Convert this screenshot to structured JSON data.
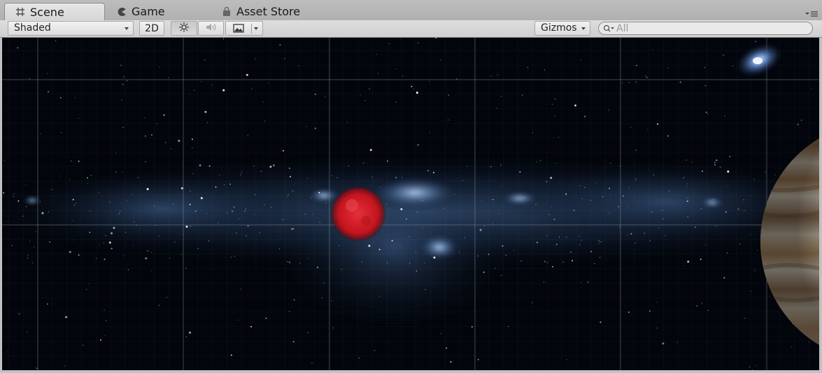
{
  "tabs": [
    {
      "label": "Scene",
      "icon": "grid-icon",
      "active": true
    },
    {
      "label": "Game",
      "icon": "pacman-icon",
      "active": false
    },
    {
      "label": "Asset Store",
      "icon": "bag-icon",
      "active": false
    }
  ],
  "toolbar": {
    "shading_mode": "Shaded",
    "mode_2d_label": "2D",
    "lighting_icon": "sun-icon",
    "audio_icon": "speaker-icon",
    "effects_icon": "image-icon",
    "gizmos_label": "Gizmos",
    "search_placeholder": "All"
  },
  "scene": {
    "objects": [
      {
        "name": "red-planet",
        "color": "#d21a22"
      },
      {
        "name": "gas-giant-planet",
        "color": "#c8a276"
      },
      {
        "name": "spiral-galaxy",
        "color": "#5d86c4"
      }
    ],
    "background": "milky-way-starfield",
    "grid_visible": true
  }
}
